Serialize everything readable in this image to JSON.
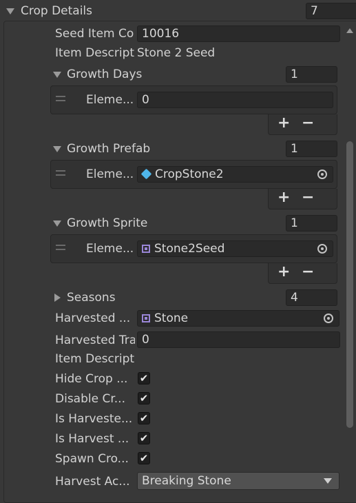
{
  "header": {
    "title": "Crop Details",
    "count": "7"
  },
  "seed_item_code": {
    "label": "Seed Item Co",
    "value": "10016"
  },
  "item_description": {
    "label": "Item Descript",
    "value": "Stone 2 Seed"
  },
  "growth_days": {
    "label": "Growth Days",
    "size": "1",
    "element_label": "Eleme...",
    "element_value": "0"
  },
  "growth_prefab": {
    "label": "Growth Prefab",
    "size": "1",
    "element_label": "Eleme...",
    "element_value": "CropStone2",
    "icon": "prefab-cube-icon"
  },
  "growth_sprite": {
    "label": "Growth Sprite",
    "size": "1",
    "element_label": "Eleme...",
    "element_value": "Stone2Seed",
    "icon": "sprite-icon"
  },
  "seasons": {
    "label": "Seasons",
    "size": "4"
  },
  "harvested_sprite": {
    "label": "Harvested ...",
    "value": "Stone"
  },
  "harvested_transform": {
    "label": "Harvested Tra",
    "value": "0"
  },
  "item_description_2": {
    "label": "Item Descript"
  },
  "toggles": [
    {
      "label": "Hide Crop ...",
      "checked": true
    },
    {
      "label": "Disable Cr...",
      "checked": true
    },
    {
      "label": "Is Harveste...",
      "checked": true
    },
    {
      "label": "Is Harvest ...",
      "checked": true
    },
    {
      "label": "Spawn Cro...",
      "checked": true
    }
  ],
  "harvest_action": {
    "label": "Harvest Ac...",
    "value": "Breaking Stone"
  },
  "glyphs": {
    "plus": "+",
    "minus": "−",
    "check": "✔"
  },
  "colors": {
    "background": "#383838",
    "field": "#2a2a2a",
    "text": "#d2d2d2"
  }
}
